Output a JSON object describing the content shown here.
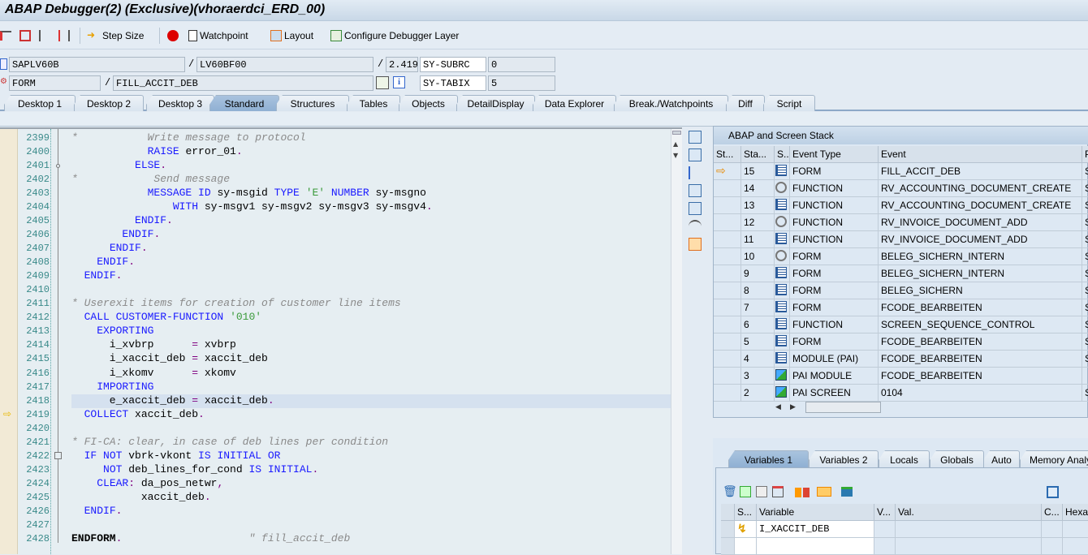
{
  "window": {
    "title": "ABAP Debugger(2)  (Exclusive)(vhoraerdci_ERD_00)"
  },
  "toolbar": {
    "step_size": "Step Size",
    "watchpoint": "Watchpoint",
    "layout": "Layout",
    "configure_layer": "Configure Debugger Layer"
  },
  "info": {
    "program": "SAPLV60B",
    "include": "LV60BF00",
    "line": "2.419",
    "event_type": "FORM",
    "event": "FILL_ACCIT_DEB",
    "sy_subrc_label": "SY-SUBRC",
    "sy_subrc_value": "0",
    "sy_tabix_label": "SY-TABIX",
    "sy_tabix_value": "5",
    "slash": "/"
  },
  "tabs": [
    "Desktop 1",
    "Desktop 2",
    "Desktop 3",
    "Standard",
    "Structures",
    "Tables",
    "Objects",
    "DetailDisplay",
    "Data Explorer",
    "Break./Watchpoints",
    "Diff",
    "Script"
  ],
  "active_tab": "Standard",
  "code": {
    "current_line": 2419,
    "highlight_line": 2418,
    "lines": [
      {
        "n": "2399",
        "s": [
          [
            "cm",
            "*           Write message to protocol"
          ]
        ]
      },
      {
        "n": "2400",
        "s": [
          [
            "id",
            "            "
          ],
          [
            "kw",
            "RAISE"
          ],
          [
            "id",
            " error_01"
          ],
          [
            "pu",
            "."
          ]
        ]
      },
      {
        "n": "2401",
        "s": [
          [
            "id",
            "          "
          ],
          [
            "kw",
            "ELSE"
          ],
          [
            "pu",
            "."
          ]
        ]
      },
      {
        "n": "2402",
        "s": [
          [
            "cm",
            "*            Send message"
          ]
        ]
      },
      {
        "n": "2403",
        "s": [
          [
            "id",
            "            "
          ],
          [
            "kw",
            "MESSAGE ID"
          ],
          [
            "id",
            " sy-msgid "
          ],
          [
            "kw",
            "TYPE"
          ],
          [
            "id",
            " "
          ],
          [
            "st",
            "'E'"
          ],
          [
            "id",
            " "
          ],
          [
            "kw",
            "NUMBER"
          ],
          [
            "id",
            " sy-msgno"
          ]
        ]
      },
      {
        "n": "2404",
        "s": [
          [
            "id",
            "                "
          ],
          [
            "kw",
            "WITH"
          ],
          [
            "id",
            " sy-msgv1 sy-msgv2 sy-msgv3 sy-msgv4"
          ],
          [
            "pu",
            "."
          ]
        ]
      },
      {
        "n": "2405",
        "s": [
          [
            "id",
            "          "
          ],
          [
            "kw",
            "ENDIF"
          ],
          [
            "pu",
            "."
          ]
        ]
      },
      {
        "n": "2406",
        "s": [
          [
            "id",
            "        "
          ],
          [
            "kw",
            "ENDIF"
          ],
          [
            "pu",
            "."
          ]
        ]
      },
      {
        "n": "2407",
        "s": [
          [
            "id",
            "      "
          ],
          [
            "kw",
            "ENDIF"
          ],
          [
            "pu",
            "."
          ]
        ]
      },
      {
        "n": "2408",
        "s": [
          [
            "id",
            "    "
          ],
          [
            "kw",
            "ENDIF"
          ],
          [
            "pu",
            "."
          ]
        ]
      },
      {
        "n": "2409",
        "s": [
          [
            "id",
            "  "
          ],
          [
            "kw",
            "ENDIF"
          ],
          [
            "pu",
            "."
          ]
        ]
      },
      {
        "n": "2410",
        "s": []
      },
      {
        "n": "2411",
        "s": [
          [
            "cm",
            "* Userexit items for creation of customer line items"
          ]
        ]
      },
      {
        "n": "2412",
        "s": [
          [
            "id",
            "  "
          ],
          [
            "kw",
            "CALL CUSTOMER-FUNCTION"
          ],
          [
            "id",
            " "
          ],
          [
            "st",
            "'010'"
          ]
        ]
      },
      {
        "n": "2413",
        "s": [
          [
            "id",
            "    "
          ],
          [
            "kw",
            "EXPORTING"
          ]
        ]
      },
      {
        "n": "2414",
        "s": [
          [
            "id",
            "      i_xvbrp      "
          ],
          [
            "pu",
            "="
          ],
          [
            "id",
            " xvbrp"
          ]
        ]
      },
      {
        "n": "2415",
        "s": [
          [
            "id",
            "      i_xaccit_deb "
          ],
          [
            "pu",
            "="
          ],
          [
            "id",
            " xaccit_deb"
          ]
        ]
      },
      {
        "n": "2416",
        "s": [
          [
            "id",
            "      i_xkomv      "
          ],
          [
            "pu",
            "="
          ],
          [
            "id",
            " xkomv"
          ]
        ]
      },
      {
        "n": "2417",
        "s": [
          [
            "id",
            "    "
          ],
          [
            "kw",
            "IMPORTING"
          ]
        ]
      },
      {
        "n": "2418",
        "s": [
          [
            "id",
            "      e_xaccit_deb "
          ],
          [
            "pu",
            "="
          ],
          [
            "id",
            " xaccit_deb"
          ],
          [
            "pu",
            "."
          ]
        ]
      },
      {
        "n": "2419",
        "s": [
          [
            "id",
            "  "
          ],
          [
            "kw",
            "COLLECT"
          ],
          [
            "id",
            " xaccit_deb"
          ],
          [
            "pu",
            "."
          ]
        ]
      },
      {
        "n": "2420",
        "s": []
      },
      {
        "n": "2421",
        "s": [
          [
            "cm",
            "* FI-CA: clear, in case of deb lines per condition"
          ]
        ]
      },
      {
        "n": "2422",
        "s": [
          [
            "id",
            "  "
          ],
          [
            "kw",
            "IF NOT"
          ],
          [
            "id",
            " vbrk-vkont "
          ],
          [
            "kw",
            "IS INITIAL OR"
          ]
        ]
      },
      {
        "n": "2423",
        "s": [
          [
            "id",
            "     "
          ],
          [
            "kw",
            "NOT"
          ],
          [
            "id",
            " deb_lines_for_cond "
          ],
          [
            "kw",
            "IS INITIAL"
          ],
          [
            "pu",
            "."
          ]
        ]
      },
      {
        "n": "2424",
        "s": [
          [
            "id",
            "    "
          ],
          [
            "kw",
            "CLEAR"
          ],
          [
            "pu",
            ":"
          ],
          [
            "id",
            " da_pos_netwr"
          ],
          [
            "pu",
            ","
          ]
        ]
      },
      {
        "n": "2425",
        "s": [
          [
            "id",
            "           xaccit_deb"
          ],
          [
            "pu",
            "."
          ]
        ]
      },
      {
        "n": "2426",
        "s": [
          [
            "id",
            "  "
          ],
          [
            "kw",
            "ENDIF"
          ],
          [
            "pu",
            "."
          ]
        ]
      },
      {
        "n": "2427",
        "s": []
      },
      {
        "n": "2428",
        "s": [
          [
            "bd",
            "ENDFORM"
          ],
          [
            "pu",
            "."
          ],
          [
            "id",
            "                    "
          ],
          [
            "cm",
            "\" fill_accit_deb"
          ]
        ]
      }
    ]
  },
  "stack": {
    "title": "ABAP and Screen Stack",
    "columns": [
      "St...",
      "Sta...",
      "S..",
      "Event Type",
      "Event",
      "P"
    ],
    "rows": [
      {
        "level": "15",
        "icon": "source-icon",
        "type": "FORM",
        "event": "FILL_ACCIT_DEB",
        "p": "S",
        "current": true
      },
      {
        "level": "14",
        "icon": "spiral-icon",
        "type": "FUNCTION",
        "event": "RV_ACCOUNTING_DOCUMENT_CREATE",
        "p": "S"
      },
      {
        "level": "13",
        "icon": "source-icon",
        "type": "FUNCTION",
        "event": "RV_ACCOUNTING_DOCUMENT_CREATE",
        "p": "S"
      },
      {
        "level": "12",
        "icon": "spiral-icon",
        "type": "FUNCTION",
        "event": "RV_INVOICE_DOCUMENT_ADD",
        "p": "S"
      },
      {
        "level": "11",
        "icon": "source-icon",
        "type": "FUNCTION",
        "event": "RV_INVOICE_DOCUMENT_ADD",
        "p": "S"
      },
      {
        "level": "10",
        "icon": "spiral-icon",
        "type": "FORM",
        "event": "BELEG_SICHERN_INTERN",
        "p": "S"
      },
      {
        "level": "9",
        "icon": "source-icon",
        "type": "FORM",
        "event": "BELEG_SICHERN_INTERN",
        "p": "S"
      },
      {
        "level": "8",
        "icon": "source-icon",
        "type": "FORM",
        "event": "BELEG_SICHERN",
        "p": "S"
      },
      {
        "level": "7",
        "icon": "source-icon",
        "type": "FORM",
        "event": "FCODE_BEARBEITEN",
        "p": "S"
      },
      {
        "level": "6",
        "icon": "source-icon",
        "type": "FUNCTION",
        "event": "SCREEN_SEQUENCE_CONTROL",
        "p": "S"
      },
      {
        "level": "5",
        "icon": "source-icon",
        "type": "FORM",
        "event": "FCODE_BEARBEITEN",
        "p": "S"
      },
      {
        "level": "4",
        "icon": "source-icon",
        "type": "MODULE (PAI)",
        "event": "FCODE_BEARBEITEN",
        "p": "S"
      },
      {
        "level": "3",
        "icon": "screen-icon",
        "type": "PAI MODULE",
        "event": "FCODE_BEARBEITEN",
        "p": ""
      },
      {
        "level": "2",
        "icon": "screen-icon",
        "type": "PAI SCREEN",
        "event": "0104",
        "p": "S"
      }
    ]
  },
  "variables": {
    "tabs": [
      "Variables 1",
      "Variables 2",
      "Locals",
      "Globals",
      "Auto",
      "Memory Analy"
    ],
    "columns": [
      "S...",
      "Variable",
      "V...",
      "Val.",
      "C...",
      "Hexa"
    ],
    "rows": [
      {
        "variable": "I_XACCIT_DEB",
        "icon": "lightning-icon"
      }
    ]
  },
  "colors": {
    "keyword": "#1a1aff",
    "comment": "#8a8a8a",
    "string": "#3a9a3a",
    "punct": "#800080",
    "line_numbers": "#3a8a8a",
    "active_tab": "#9ab8d8"
  }
}
